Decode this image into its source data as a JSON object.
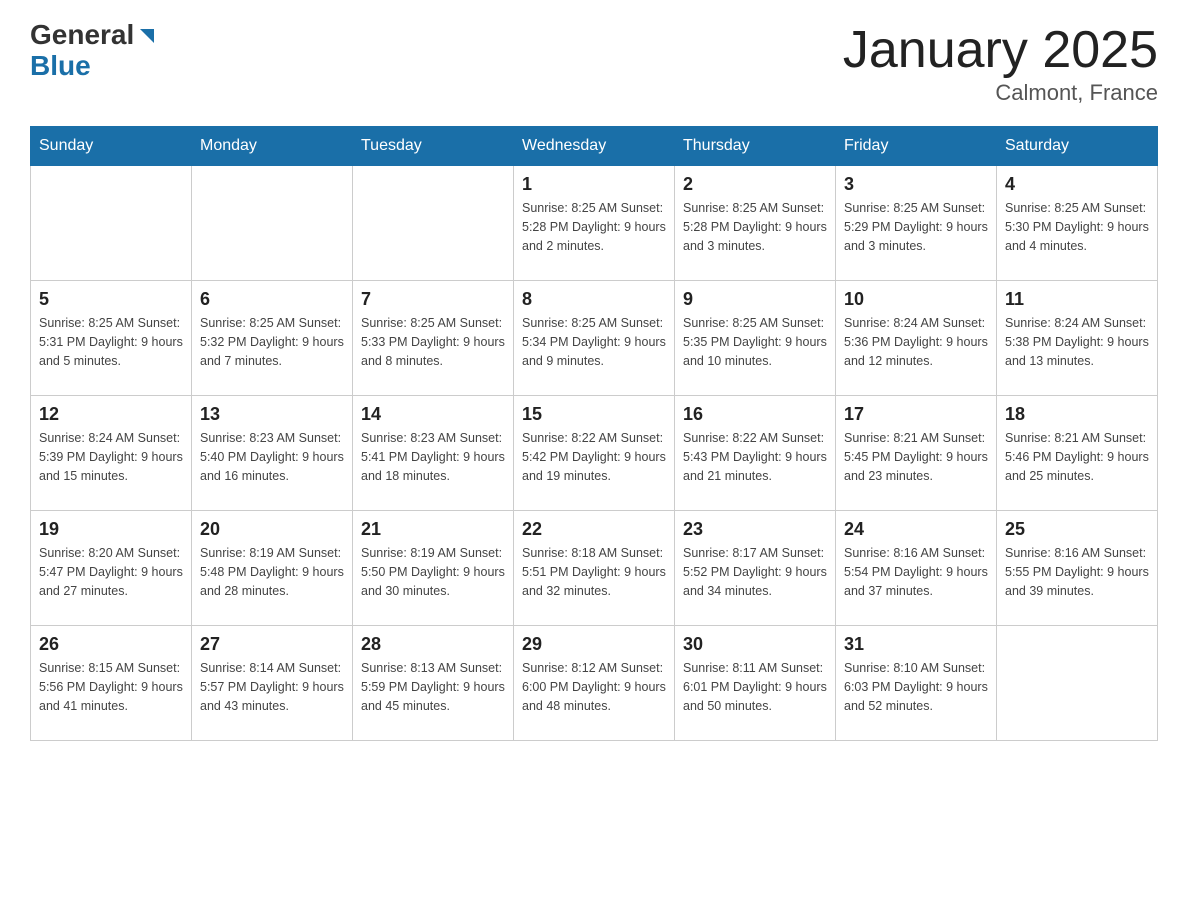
{
  "header": {
    "logo_general": "General",
    "logo_blue": "Blue",
    "title": "January 2025",
    "subtitle": "Calmont, France"
  },
  "days_of_week": [
    "Sunday",
    "Monday",
    "Tuesday",
    "Wednesday",
    "Thursday",
    "Friday",
    "Saturday"
  ],
  "weeks": [
    [
      {
        "day": "",
        "info": ""
      },
      {
        "day": "",
        "info": ""
      },
      {
        "day": "",
        "info": ""
      },
      {
        "day": "1",
        "info": "Sunrise: 8:25 AM\nSunset: 5:28 PM\nDaylight: 9 hours and 2 minutes."
      },
      {
        "day": "2",
        "info": "Sunrise: 8:25 AM\nSunset: 5:28 PM\nDaylight: 9 hours and 3 minutes."
      },
      {
        "day": "3",
        "info": "Sunrise: 8:25 AM\nSunset: 5:29 PM\nDaylight: 9 hours and 3 minutes."
      },
      {
        "day": "4",
        "info": "Sunrise: 8:25 AM\nSunset: 5:30 PM\nDaylight: 9 hours and 4 minutes."
      }
    ],
    [
      {
        "day": "5",
        "info": "Sunrise: 8:25 AM\nSunset: 5:31 PM\nDaylight: 9 hours and 5 minutes."
      },
      {
        "day": "6",
        "info": "Sunrise: 8:25 AM\nSunset: 5:32 PM\nDaylight: 9 hours and 7 minutes."
      },
      {
        "day": "7",
        "info": "Sunrise: 8:25 AM\nSunset: 5:33 PM\nDaylight: 9 hours and 8 minutes."
      },
      {
        "day": "8",
        "info": "Sunrise: 8:25 AM\nSunset: 5:34 PM\nDaylight: 9 hours and 9 minutes."
      },
      {
        "day": "9",
        "info": "Sunrise: 8:25 AM\nSunset: 5:35 PM\nDaylight: 9 hours and 10 minutes."
      },
      {
        "day": "10",
        "info": "Sunrise: 8:24 AM\nSunset: 5:36 PM\nDaylight: 9 hours and 12 minutes."
      },
      {
        "day": "11",
        "info": "Sunrise: 8:24 AM\nSunset: 5:38 PM\nDaylight: 9 hours and 13 minutes."
      }
    ],
    [
      {
        "day": "12",
        "info": "Sunrise: 8:24 AM\nSunset: 5:39 PM\nDaylight: 9 hours and 15 minutes."
      },
      {
        "day": "13",
        "info": "Sunrise: 8:23 AM\nSunset: 5:40 PM\nDaylight: 9 hours and 16 minutes."
      },
      {
        "day": "14",
        "info": "Sunrise: 8:23 AM\nSunset: 5:41 PM\nDaylight: 9 hours and 18 minutes."
      },
      {
        "day": "15",
        "info": "Sunrise: 8:22 AM\nSunset: 5:42 PM\nDaylight: 9 hours and 19 minutes."
      },
      {
        "day": "16",
        "info": "Sunrise: 8:22 AM\nSunset: 5:43 PM\nDaylight: 9 hours and 21 minutes."
      },
      {
        "day": "17",
        "info": "Sunrise: 8:21 AM\nSunset: 5:45 PM\nDaylight: 9 hours and 23 minutes."
      },
      {
        "day": "18",
        "info": "Sunrise: 8:21 AM\nSunset: 5:46 PM\nDaylight: 9 hours and 25 minutes."
      }
    ],
    [
      {
        "day": "19",
        "info": "Sunrise: 8:20 AM\nSunset: 5:47 PM\nDaylight: 9 hours and 27 minutes."
      },
      {
        "day": "20",
        "info": "Sunrise: 8:19 AM\nSunset: 5:48 PM\nDaylight: 9 hours and 28 minutes."
      },
      {
        "day": "21",
        "info": "Sunrise: 8:19 AM\nSunset: 5:50 PM\nDaylight: 9 hours and 30 minutes."
      },
      {
        "day": "22",
        "info": "Sunrise: 8:18 AM\nSunset: 5:51 PM\nDaylight: 9 hours and 32 minutes."
      },
      {
        "day": "23",
        "info": "Sunrise: 8:17 AM\nSunset: 5:52 PM\nDaylight: 9 hours and 34 minutes."
      },
      {
        "day": "24",
        "info": "Sunrise: 8:16 AM\nSunset: 5:54 PM\nDaylight: 9 hours and 37 minutes."
      },
      {
        "day": "25",
        "info": "Sunrise: 8:16 AM\nSunset: 5:55 PM\nDaylight: 9 hours and 39 minutes."
      }
    ],
    [
      {
        "day": "26",
        "info": "Sunrise: 8:15 AM\nSunset: 5:56 PM\nDaylight: 9 hours and 41 minutes."
      },
      {
        "day": "27",
        "info": "Sunrise: 8:14 AM\nSunset: 5:57 PM\nDaylight: 9 hours and 43 minutes."
      },
      {
        "day": "28",
        "info": "Sunrise: 8:13 AM\nSunset: 5:59 PM\nDaylight: 9 hours and 45 minutes."
      },
      {
        "day": "29",
        "info": "Sunrise: 8:12 AM\nSunset: 6:00 PM\nDaylight: 9 hours and 48 minutes."
      },
      {
        "day": "30",
        "info": "Sunrise: 8:11 AM\nSunset: 6:01 PM\nDaylight: 9 hours and 50 minutes."
      },
      {
        "day": "31",
        "info": "Sunrise: 8:10 AM\nSunset: 6:03 PM\nDaylight: 9 hours and 52 minutes."
      },
      {
        "day": "",
        "info": ""
      }
    ]
  ]
}
